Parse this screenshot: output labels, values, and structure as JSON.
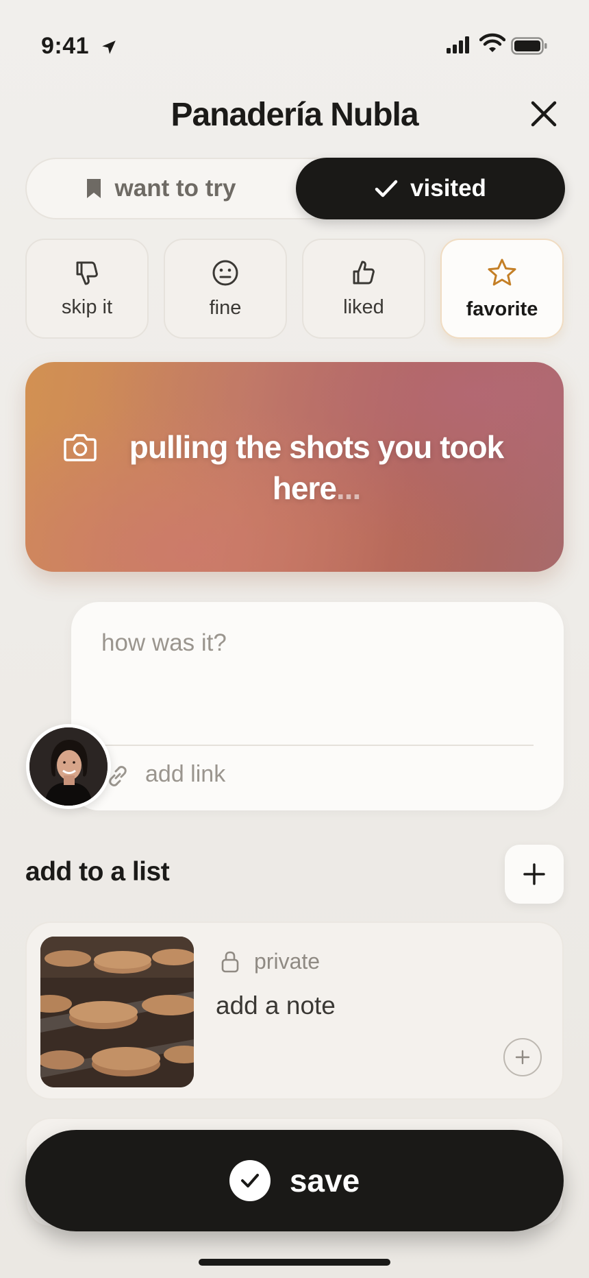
{
  "status_bar": {
    "time": "9:41"
  },
  "header": {
    "title": "Panadería Nubla"
  },
  "segmented": {
    "want_label": "want to try",
    "visited_label": "visited",
    "selected": "visited"
  },
  "ratings": [
    {
      "label": "skip it",
      "icon": "thumbs-down-icon",
      "selected": false
    },
    {
      "label": "fine",
      "icon": "neutral-face-icon",
      "selected": false
    },
    {
      "label": "liked",
      "icon": "thumbs-up-icon",
      "selected": false
    },
    {
      "label": "favorite",
      "icon": "star-icon",
      "selected": true
    }
  ],
  "banner": {
    "text": "pulling the shots you took here",
    "ellipsis": "..."
  },
  "note": {
    "placeholder": "how was it?",
    "add_link_label": "add link"
  },
  "lists": {
    "title": "add to a list",
    "items": [
      {
        "privacy": "private",
        "note": "add a note"
      }
    ]
  },
  "save": {
    "label": "save"
  },
  "colors": {
    "accent": "#1a1917",
    "star": "#c47f26",
    "banner_start": "#d29152",
    "banner_end": "#a86a6c"
  }
}
